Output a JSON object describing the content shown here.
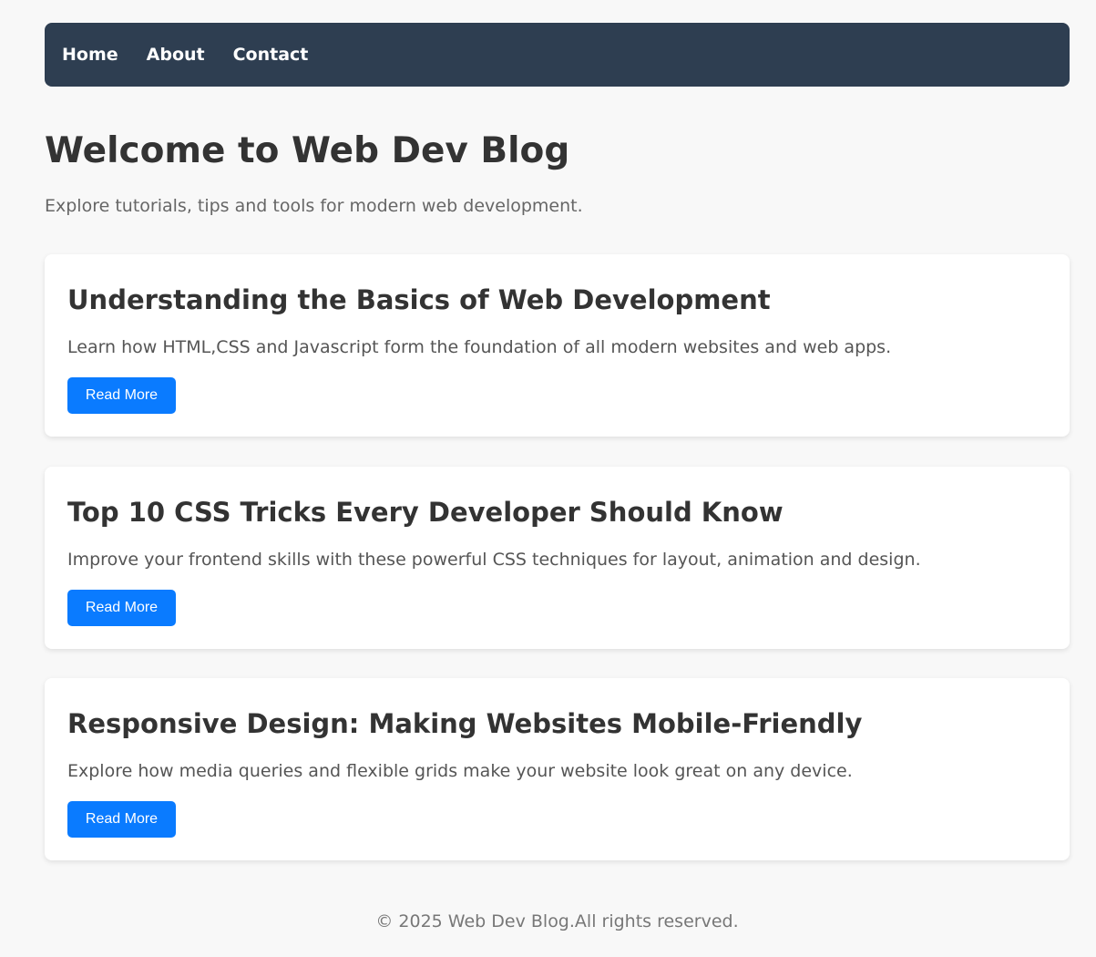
{
  "nav": {
    "items": [
      {
        "label": "Home"
      },
      {
        "label": "About"
      },
      {
        "label": "Contact"
      }
    ]
  },
  "hero": {
    "title": "Welcome to Web Dev Blog",
    "subtitle": "Explore tutorials, tips and tools for modern web development."
  },
  "posts": [
    {
      "title": "Understanding the Basics of Web Development",
      "excerpt": "Learn how HTML,CSS and Javascript form the foundation of all modern websites and web apps.",
      "button_label": "Read More"
    },
    {
      "title": "Top 10 CSS Tricks Every Developer Should Know",
      "excerpt": "Improve your frontend skills with these powerful CSS techniques for layout, animation and design.",
      "button_label": "Read More"
    },
    {
      "title": "Responsive Design: Making Websites Mobile-Friendly",
      "excerpt": "Explore how media queries and flexible grids make your website look great on any device.",
      "button_label": "Read More"
    }
  ],
  "footer": {
    "text": "© 2025 Web Dev Blog.All rights reserved."
  },
  "colors": {
    "nav_background": "#2e3e51",
    "button_background": "#0a7bff",
    "page_background": "#f8f8f8"
  }
}
